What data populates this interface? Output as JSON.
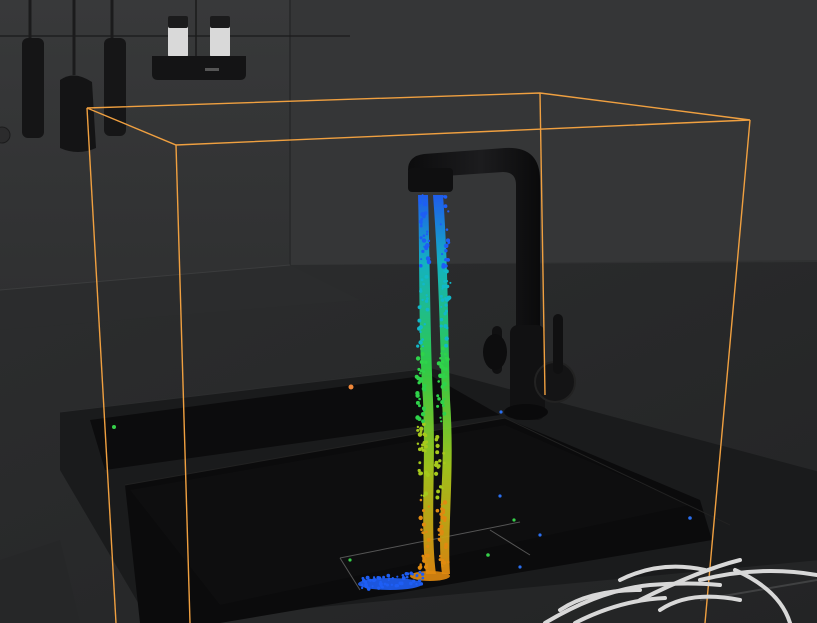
{
  "viewport": {
    "label": ""
  },
  "scene": {
    "objects": [
      "kitchen-back-wall",
      "countertop",
      "hanging-utensils",
      "wall-shelf-with-jars",
      "double-sink",
      "black-faucet",
      "water-particle-stream",
      "simulation-bounding-box",
      "dish-rack"
    ]
  },
  "colors": {
    "background_wall": "#343536",
    "countertop": "#2a2b2c",
    "sink_basin": "#0b0b0c",
    "faucet": "#101011",
    "bounding_box": "#f0a040",
    "particle_low_speed": "#2a6ff0",
    "particle_mid_speed": "#36d04a",
    "particle_high_speed": "#e08a10",
    "dish_rack": "#d8d8d8"
  },
  "particles": {
    "color_map": [
      "#1e5ef5",
      "#12b8c8",
      "#2fd34a",
      "#a6c91c",
      "#e08a10"
    ]
  }
}
